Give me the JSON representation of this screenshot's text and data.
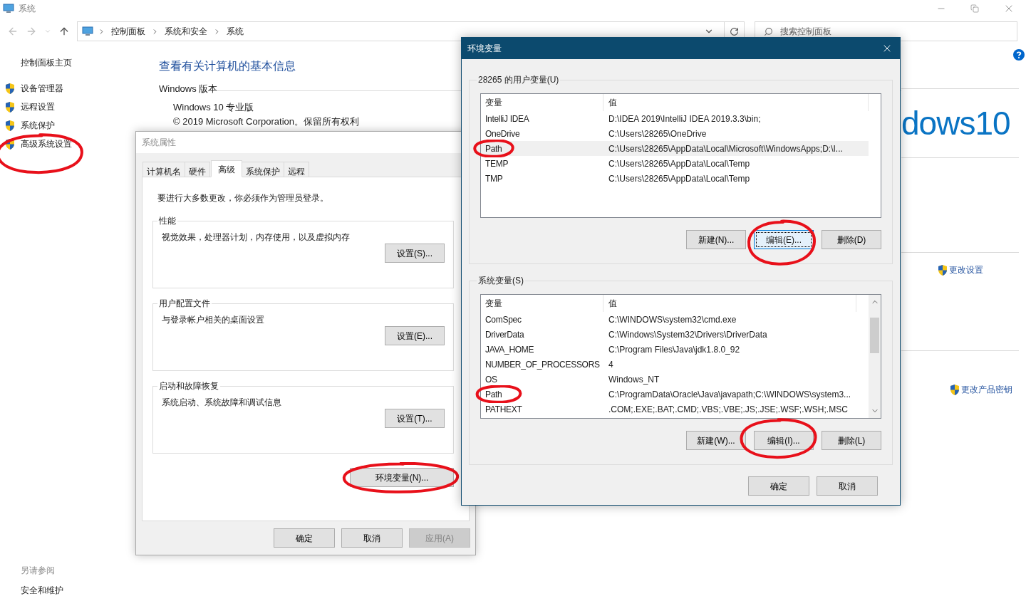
{
  "window": {
    "title": "系统"
  },
  "nav": {
    "breadcrumbs": [
      "控制面板",
      "系统和安全",
      "系统"
    ],
    "search": {
      "placeholder": "搜索控制面板"
    }
  },
  "sidebar": {
    "home": "控制面板主页",
    "items": [
      {
        "label": "设备管理器",
        "circled": false
      },
      {
        "label": "远程设置",
        "circled": false
      },
      {
        "label": "系统保护",
        "circled": false
      },
      {
        "label": "高级系统设置",
        "circled": true
      }
    ],
    "see_also": {
      "title": "另请参阅",
      "links": [
        "安全和维护"
      ]
    }
  },
  "content": {
    "heading": "查看有关计算机的基本信息",
    "section": "Windows 版本",
    "edition": "Windows 10 专业版",
    "copyright": "© 2019 Microsoft Corporation。保留所有权利",
    "logo": "dows10",
    "links": [
      "更改设置",
      "更改产品密钥"
    ]
  },
  "system_properties": {
    "title": "系统属性",
    "active": false,
    "tabs": [
      {
        "label": "计算机名",
        "selected": false
      },
      {
        "label": "硬件",
        "selected": false
      },
      {
        "label": "高级",
        "selected": true
      },
      {
        "label": "系统保护",
        "selected": false
      },
      {
        "label": "远程",
        "selected": false
      }
    ],
    "notice": "要进行大多数更改，你必须作为管理员登录。",
    "groups": [
      {
        "title": "性能",
        "description": "视觉效果，处理器计划，内存使用，以及虚拟内存",
        "button": "设置(S)..."
      },
      {
        "title": "用户配置文件",
        "description": "与登录帐户相关的桌面设置",
        "button": "设置(E)..."
      },
      {
        "title": "启动和故障恢复",
        "description": "系统启动、系统故障和调试信息",
        "button": "设置(T)..."
      }
    ],
    "env_button": {
      "label": "环境变量(N)...",
      "circled": true
    },
    "buttons": [
      {
        "label": "确定",
        "disabled": false
      },
      {
        "label": "取消",
        "disabled": false
      },
      {
        "label": "应用(A)",
        "disabled": true
      }
    ]
  },
  "env_dialog": {
    "title": "环境变量",
    "active": true,
    "groups": [
      {
        "title": "28265 的用户变量(U)",
        "columns": [
          "变量",
          "值"
        ],
        "scrollbar": false,
        "rows": [
          {
            "name": "IntelliJ IDEA",
            "value": "D:\\IDEA 2019\\IntelliJ IDEA 2019.3.3\\bin;",
            "selected": false,
            "circled": false
          },
          {
            "name": "OneDrive",
            "value": "C:\\Users\\28265\\OneDrive",
            "selected": false,
            "circled": false
          },
          {
            "name": "Path",
            "value": "C:\\Users\\28265\\AppData\\Local\\Microsoft\\WindowsApps;D:\\I...",
            "selected": true,
            "circled": true
          },
          {
            "name": "TEMP",
            "value": "C:\\Users\\28265\\AppData\\Local\\Temp",
            "selected": false,
            "circled": false
          },
          {
            "name": "TMP",
            "value": "C:\\Users\\28265\\AppData\\Local\\Temp",
            "selected": false,
            "circled": false
          }
        ],
        "buttons": [
          {
            "label": "新建(N)...",
            "focused": false,
            "circled": false
          },
          {
            "label": "编辑(E)...",
            "focused": true,
            "circled": true
          },
          {
            "label": "删除(D)",
            "focused": false,
            "circled": false
          }
        ]
      },
      {
        "title": "系统变量(S)",
        "columns": [
          "变量",
          "值"
        ],
        "scrollbar": true,
        "rows": [
          {
            "name": "ComSpec",
            "value": "C:\\WINDOWS\\system32\\cmd.exe",
            "selected": false,
            "circled": false
          },
          {
            "name": "DriverData",
            "value": "C:\\Windows\\System32\\Drivers\\DriverData",
            "selected": false,
            "circled": false
          },
          {
            "name": "JAVA_HOME",
            "value": "C:\\Program Files\\Java\\jdk1.8.0_92",
            "selected": false,
            "circled": false
          },
          {
            "name": "NUMBER_OF_PROCESSORS",
            "value": "4",
            "selected": false,
            "circled": false
          },
          {
            "name": "OS",
            "value": "Windows_NT",
            "selected": false,
            "circled": false
          },
          {
            "name": "Path",
            "value": "C:\\ProgramData\\Oracle\\Java\\javapath;C:\\WINDOWS\\system3...",
            "selected": false,
            "circled": true
          },
          {
            "name": "PATHEXT",
            "value": ".COM;.EXE;.BAT;.CMD;.VBS;.VBE;.JS;.JSE;.WSF;.WSH;.MSC",
            "selected": false,
            "circled": false
          }
        ],
        "buttons": [
          {
            "label": "新建(W)...",
            "focused": false,
            "circled": false
          },
          {
            "label": "编辑(I)...",
            "focused": false,
            "circled": true
          },
          {
            "label": "删除(L)",
            "focused": false,
            "circled": false
          }
        ]
      }
    ],
    "buttons": [
      "确定",
      "取消"
    ]
  }
}
